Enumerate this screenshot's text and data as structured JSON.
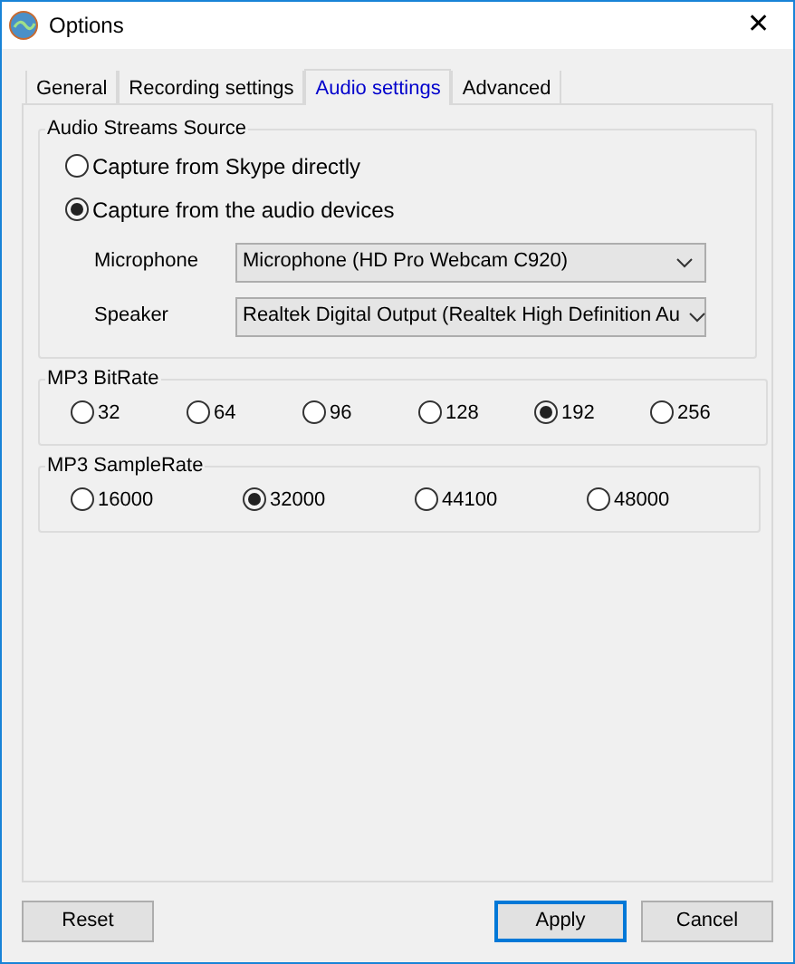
{
  "window": {
    "title": "Options",
    "close": "✕"
  },
  "tabs": [
    {
      "label": "General",
      "selected": false
    },
    {
      "label": "Recording settings",
      "selected": false
    },
    {
      "label": "Audio settings",
      "selected": true
    },
    {
      "label": "Advanced",
      "selected": false
    }
  ],
  "source_group": {
    "title": "Audio Streams Source",
    "options": [
      {
        "label": "Capture from Skype directly",
        "selected": false
      },
      {
        "label": "Capture from the audio devices",
        "selected": true
      }
    ],
    "devices": [
      {
        "label": "Microphone",
        "value": "Microphone (HD Pro Webcam C920)"
      },
      {
        "label": "Speaker",
        "value": "Realtek Digital Output (Realtek High Definition Au"
      }
    ]
  },
  "bitrate_group": {
    "title": "MP3 BitRate",
    "options": [
      {
        "label": "32",
        "selected": false
      },
      {
        "label": "64",
        "selected": false
      },
      {
        "label": "96",
        "selected": false
      },
      {
        "label": "128",
        "selected": false
      },
      {
        "label": "192",
        "selected": true
      },
      {
        "label": "256",
        "selected": false
      }
    ]
  },
  "samplerate_group": {
    "title": "MP3 SampleRate",
    "options": [
      {
        "label": "16000",
        "selected": false
      },
      {
        "label": "32000",
        "selected": true
      },
      {
        "label": "44100",
        "selected": false
      },
      {
        "label": "48000",
        "selected": false
      }
    ]
  },
  "buttons": [
    {
      "label": "Reset",
      "default": false
    },
    {
      "label": "Apply",
      "default": true
    },
    {
      "label": "Cancel",
      "default": false
    }
  ]
}
